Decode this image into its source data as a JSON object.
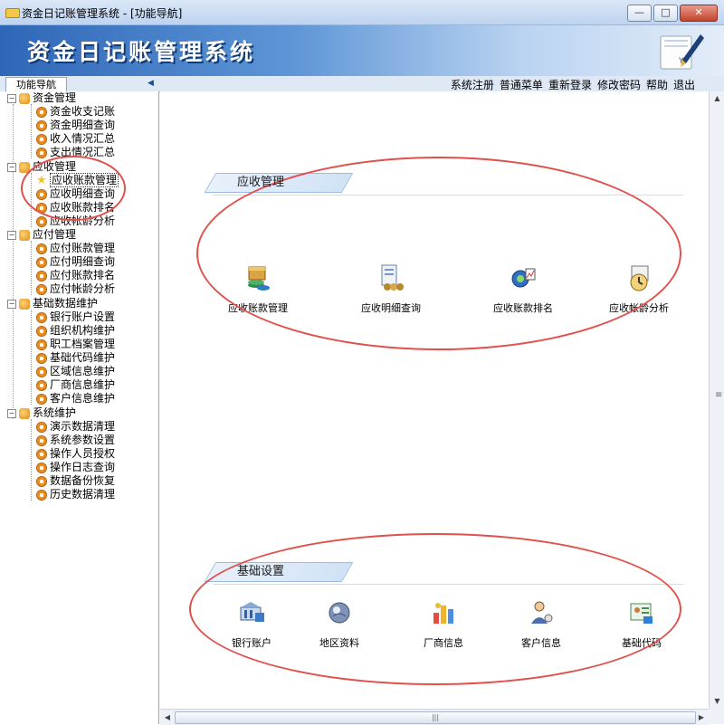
{
  "window": {
    "title": "资金日记账管理系统 - [功能导航]",
    "min": "0",
    "max": "1",
    "close": "r"
  },
  "banner": {
    "title": "资金日记账管理系统"
  },
  "navbar": {
    "tab": "功能导航",
    "menu": [
      "系统注册",
      "普通菜单",
      "重新登录",
      "修改密码",
      "帮助",
      "退出"
    ]
  },
  "tree": {
    "groups": [
      {
        "label": "资金管理",
        "items": [
          "资金收支记账",
          "资金明细查询",
          "收入情况汇总",
          "支出情况汇总"
        ]
      },
      {
        "label": "应收管理",
        "items": [
          "应收账款管理",
          "应收明细查询",
          "应收账款排名",
          "应收帐龄分析"
        ]
      },
      {
        "label": "应付管理",
        "items": [
          "应付账款管理",
          "应付明细查询",
          "应付账款排名",
          "应付帐龄分析"
        ]
      },
      {
        "label": "基础数据维护",
        "items": [
          "银行账户设置",
          "组织机构维护",
          "职工档案管理",
          "基础代码维护",
          "区域信息维护",
          "厂商信息维护",
          "客户信息维护"
        ]
      },
      {
        "label": "系统维护",
        "items": [
          "演示数据清理",
          "系统参数设置",
          "操作人员授权",
          "操作日志查询",
          "数据备份恢复",
          "历史数据清理"
        ]
      }
    ]
  },
  "main": {
    "section1": {
      "title": "应收管理",
      "items": [
        "应收账款管理",
        "应收明细查询",
        "应收账款排名",
        "应收帐龄分析"
      ]
    },
    "section2": {
      "title": "基础设置",
      "items": [
        "银行账户",
        "地区资料",
        "厂商信息",
        "客户信息",
        "基础代码"
      ]
    }
  },
  "colors": {
    "highlight_ellipse": "#e0504c",
    "banner": "#2f67b8"
  }
}
